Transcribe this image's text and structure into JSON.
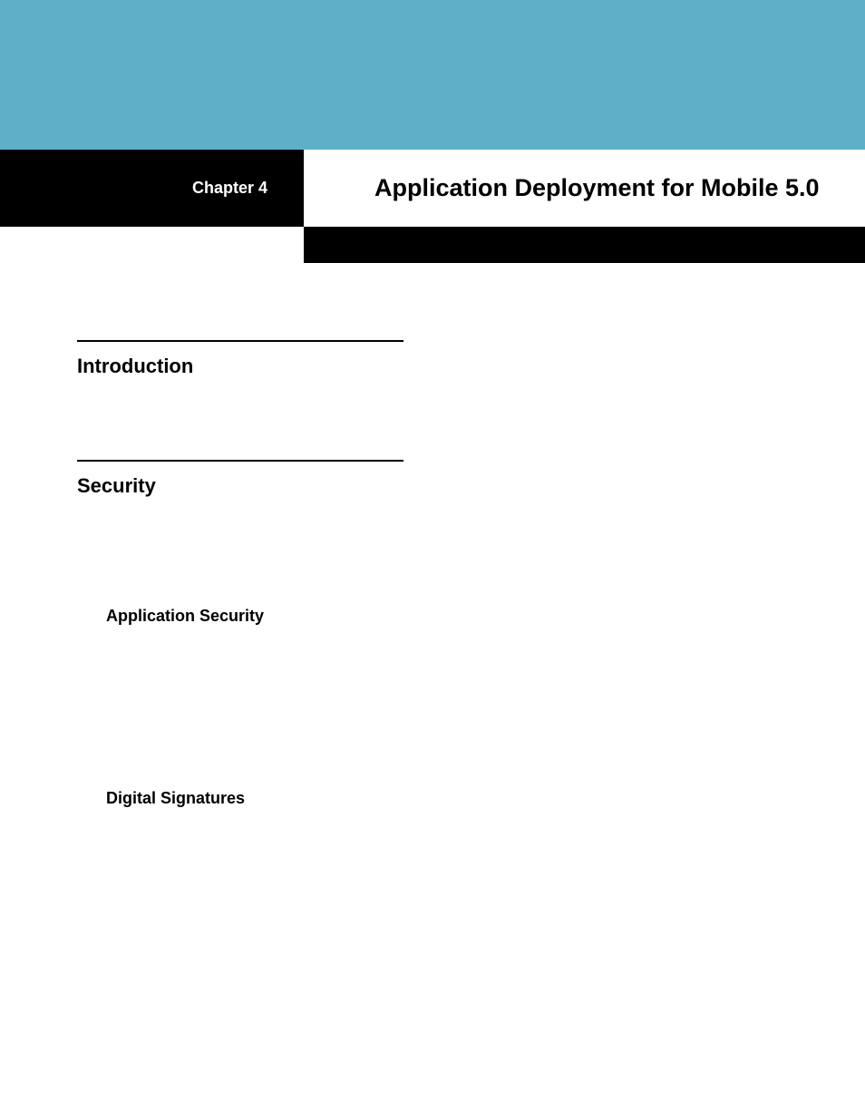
{
  "header": {
    "chapter_label": "Chapter 4",
    "chapter_title": "Application Deployment for Mobile 5.0"
  },
  "sections": {
    "introduction": {
      "heading": "Introduction"
    },
    "security": {
      "heading": "Security",
      "subsections": {
        "application_security": "Application Security",
        "digital_signatures": "Digital Signatures"
      }
    }
  }
}
